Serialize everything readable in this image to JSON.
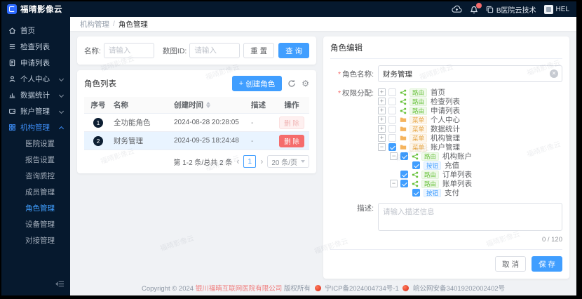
{
  "app": {
    "title": "福晴影像云"
  },
  "topbar": {
    "org": "B医院云技术",
    "user": "HEL"
  },
  "breadcrumb": {
    "parent": "机构管理",
    "sep": "/",
    "current": "角色管理"
  },
  "sidebar": {
    "items": [
      {
        "label": "首页"
      },
      {
        "label": "检查列表"
      },
      {
        "label": "申请列表"
      },
      {
        "label": "个人中心"
      },
      {
        "label": "数据统计"
      },
      {
        "label": "账户管理"
      },
      {
        "label": "机构管理"
      }
    ],
    "subitems": [
      {
        "label": "医院设置"
      },
      {
        "label": "报告设置"
      },
      {
        "label": "咨询质控"
      },
      {
        "label": "成员管理"
      },
      {
        "label": "角色管理"
      },
      {
        "label": "设备管理"
      },
      {
        "label": "对接管理"
      }
    ]
  },
  "search": {
    "name_label": "名称:",
    "name_placeholder": "请输入",
    "id_label": "数图ID:",
    "id_placeholder": "请输入",
    "reset_label": "重 置",
    "query_label": "查 询"
  },
  "role_list": {
    "title": "角色列表",
    "create_label": "创建角色",
    "columns": [
      "序号",
      "名称",
      "创建时间",
      "描述",
      "操作"
    ],
    "rows": [
      {
        "index": "1",
        "name": "全功能角色",
        "created": "2024-08-28 20:28:05",
        "desc": "-",
        "action": "删 除"
      },
      {
        "index": "2",
        "name": "财务管理",
        "created": "2024-09-25 18:24:48",
        "desc": "-",
        "action": "删 除"
      }
    ],
    "pagination": {
      "total": "第 1-2 条/总共 2 条",
      "prev": "‹",
      "page": "1",
      "next": "›",
      "size": "20 条/页"
    }
  },
  "editor": {
    "title": "角色编辑",
    "name_label": "角色名称:",
    "name_value": "财务管理",
    "perm_label": "权限分配:",
    "tree": [
      {
        "tag": "路由",
        "label": "首页"
      },
      {
        "tag": "路由",
        "label": "检查列表"
      },
      {
        "tag": "路由",
        "label": "申请列表"
      },
      {
        "tag": "菜单",
        "label": "个人中心"
      },
      {
        "tag": "菜单",
        "label": "数据统计"
      },
      {
        "tag": "菜单",
        "label": "机构管理"
      },
      {
        "tag": "菜单",
        "label": "账户管理"
      },
      {
        "tag": "路由",
        "label": "机构账户"
      },
      {
        "tag": "按钮",
        "label": "充值"
      },
      {
        "tag": "路由",
        "label": "订单列表"
      },
      {
        "tag": "路由",
        "label": "账单列表"
      },
      {
        "tag": "按钮",
        "label": "支付"
      }
    ],
    "desc_label": "描述:",
    "desc_placeholder": "请输入描述信息",
    "counter": "0 / 120",
    "cancel_label": "取 消",
    "save_label": "保 存"
  },
  "footer": {
    "prefix": "Copyright © 2024",
    "company": "银川福晴互联网医院有限公司",
    "rights": "版权所有",
    "icp": "宁ICP备2024004734号-1",
    "police": "皖公网安备34019202002402号"
  },
  "watermark": "福晴影像云",
  "colors": {
    "accent": "#409eff",
    "danger": "#f56c6c",
    "sidebar_bg": "#06192e"
  }
}
